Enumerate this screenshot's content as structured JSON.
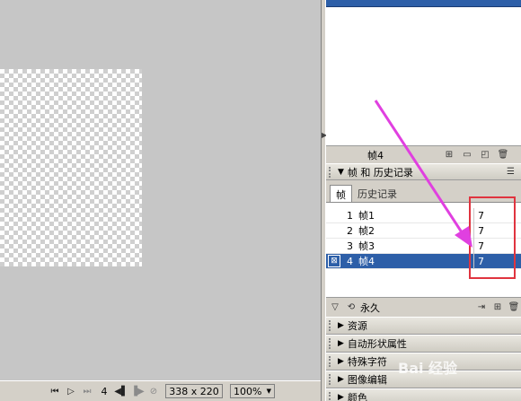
{
  "statusbar": {
    "frame_number": "4",
    "size": "338 x 220",
    "zoom": "100%",
    "zoom_arrow": "▼"
  },
  "layers_panel": {
    "footer_label": "帧4"
  },
  "frames_panel": {
    "title": "帧 和 历史记录",
    "tabs": [
      {
        "label": "帧",
        "active": true
      },
      {
        "label": "历史记录",
        "active": false
      }
    ],
    "frames": [
      {
        "index": "1",
        "name": "帧1",
        "delay": "7",
        "selected": false
      },
      {
        "index": "2",
        "name": "帧2",
        "delay": "7",
        "selected": false
      },
      {
        "index": "3",
        "name": "帧3",
        "delay": "7",
        "selected": false
      },
      {
        "index": "4",
        "name": "帧4",
        "delay": "7",
        "selected": true
      }
    ],
    "loop_label": "永久"
  },
  "collapsed_panels": [
    {
      "label": "资源"
    },
    {
      "label": "自动形状属性"
    },
    {
      "label": "特殊字符"
    },
    {
      "label": "图像编辑"
    },
    {
      "label": "颜色"
    }
  ],
  "watermark": {
    "text": "Bai 经验"
  },
  "colors": {
    "selection": "#2d5fa8",
    "annotation_red": "#e0343f",
    "annotation_arrow": "#e040e0"
  }
}
